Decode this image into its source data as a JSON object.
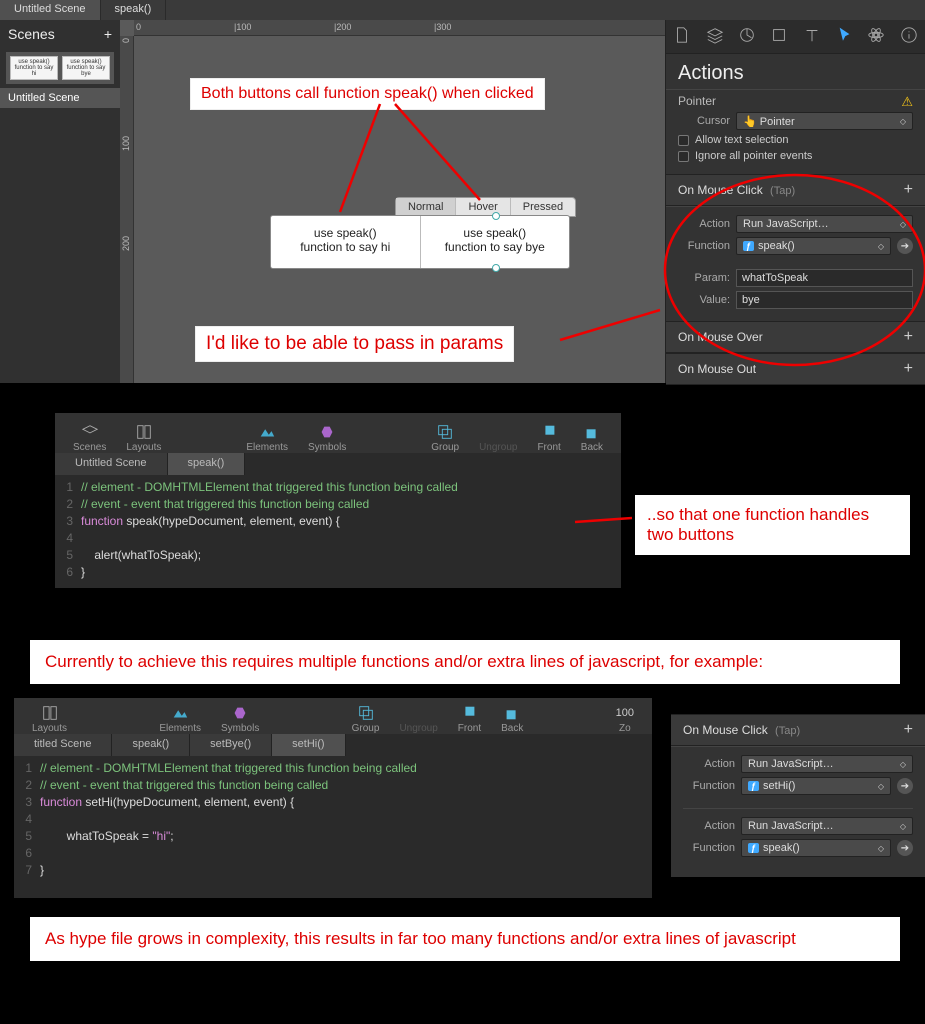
{
  "tabs": {
    "doc1": "Untitled Scene",
    "doc2": "speak()"
  },
  "scenes": {
    "title": "Scenes",
    "thumb1": "use speak() function to say hi",
    "thumb2": "use speak() function to say bye",
    "scene1": "Untitled Scene"
  },
  "ruler": {
    "t0": "0",
    "t100": "|100",
    "t200": "|200",
    "t300": "|300",
    "v0": "0",
    "v100": "100",
    "v200": "200"
  },
  "canvas": {
    "btn1_l1": "use speak()",
    "btn1_l2": "function to say hi",
    "btn2_l1": "use speak()",
    "btn2_l2": "function to say bye",
    "state_normal": "Normal",
    "state_hover": "Hover",
    "state_pressed": "Pressed"
  },
  "annotations": {
    "top": "Both buttons call function speak() when clicked",
    "mid": "I'd like to be able to pass in params",
    "right": "..so that one function handles two buttons",
    "explain1": "Currently to achieve this requires multiple functions and/or extra lines of javascript, for example:",
    "explain2": "As hype file grows in complexity, this results in far too many functions and/or extra lines of javascript"
  },
  "inspector": {
    "title": "Actions",
    "pointer_hdr": "Pointer",
    "cursor_lbl": "Cursor",
    "cursor_val": "Pointer",
    "allow_text": "Allow text selection",
    "ignore_ptr": "Ignore all pointer events",
    "click_hdr": "On Mouse Click",
    "click_sub": "(Tap)",
    "action_lbl": "Action",
    "action_val": "Run JavaScript…",
    "func_lbl": "Function",
    "func_val": "speak()",
    "param_lbl": "Param:",
    "param_val": "whatToSpeak",
    "value_lbl": "Value:",
    "value_val": "bye",
    "over_hdr": "On Mouse Over",
    "out_hdr": "On Mouse Out"
  },
  "toolbar": {
    "scenes": "Scenes",
    "layouts": "Layouts",
    "elements": "Elements",
    "symbols": "Symbols",
    "group": "Group",
    "ungroup": "Ungroup",
    "front": "Front",
    "back": "Back",
    "zoom": "100",
    "zoom_lbl": "Zo"
  },
  "code1": {
    "tab1": "Untitled Scene",
    "tab2": "speak()",
    "l1": "// element - DOMHTMLElement that triggered this function being called",
    "l2": "// event - event that triggered this function being called",
    "l3a": "function",
    "l3b": " speak(hypeDocument, element, event) {",
    "l5": "    alert(whatToSpeak);",
    "l6": "}"
  },
  "code2": {
    "tab1": "titled Scene",
    "tab2": "speak()",
    "tab3": "setBye()",
    "tab4": "setHi()",
    "l1": "// element - DOMHTMLElement that triggered this function being called",
    "l2": "// event - event that triggered this function being called",
    "l3a": "function",
    "l3b": " setHi(hypeDocument, element, event) {",
    "l5a": "        whatToSpeak = ",
    "l5b": "\"hi\"",
    "l5c": ";",
    "l7": "}"
  },
  "insp2": {
    "hdr": "On Mouse Click",
    "sub": "(Tap)",
    "a1_lbl": "Action",
    "a1_val": "Run JavaScript…",
    "f1_lbl": "Function",
    "f1_val": "setHi()",
    "a2_lbl": "Action",
    "a2_val": "Run JavaScript…",
    "f2_lbl": "Function",
    "f2_val": "speak()"
  }
}
